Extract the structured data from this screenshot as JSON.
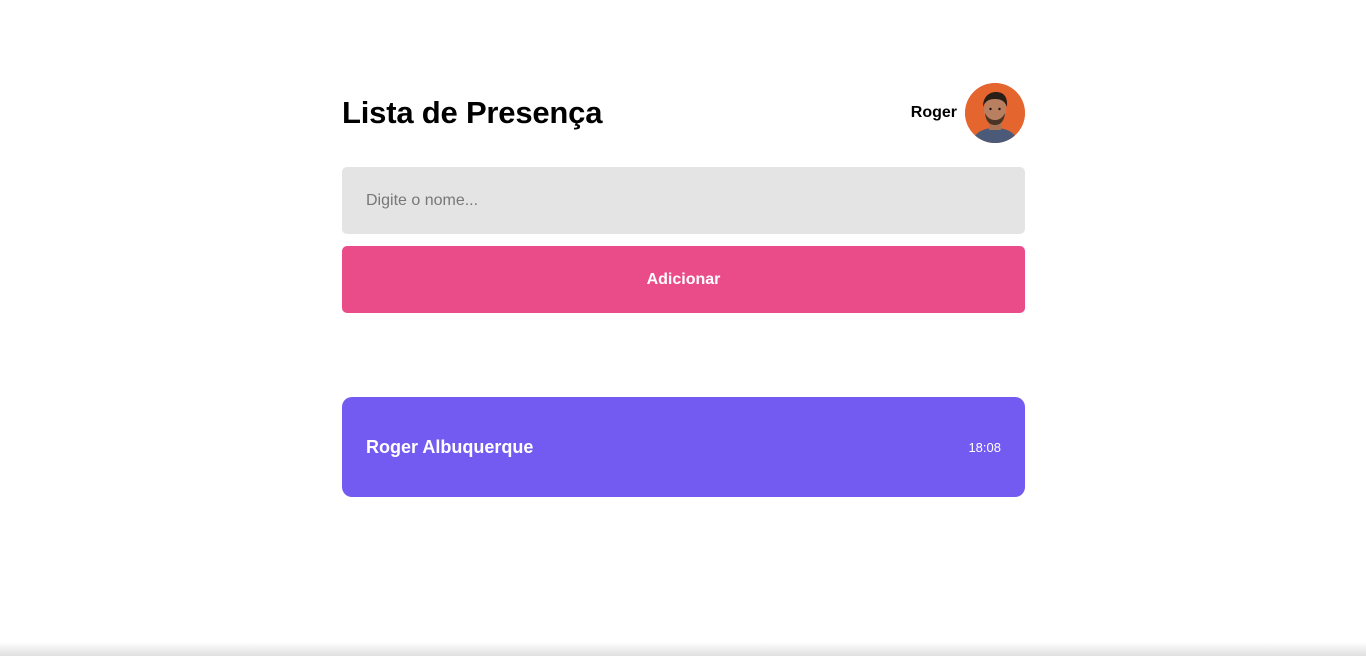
{
  "header": {
    "title": "Lista de Presença",
    "user_name": "Roger",
    "avatar_icon": "user-avatar-photo"
  },
  "form": {
    "input_placeholder": "Digite o nome...",
    "input_value": "",
    "add_label": "Adicionar"
  },
  "students": [
    {
      "name": "Roger Albuquerque",
      "time": "18:08"
    }
  ],
  "colors": {
    "accent_pink": "#ea4c89",
    "card_purple": "#735bf2",
    "input_bg": "#e4e4e4",
    "avatar_bg": "#e5652f"
  }
}
